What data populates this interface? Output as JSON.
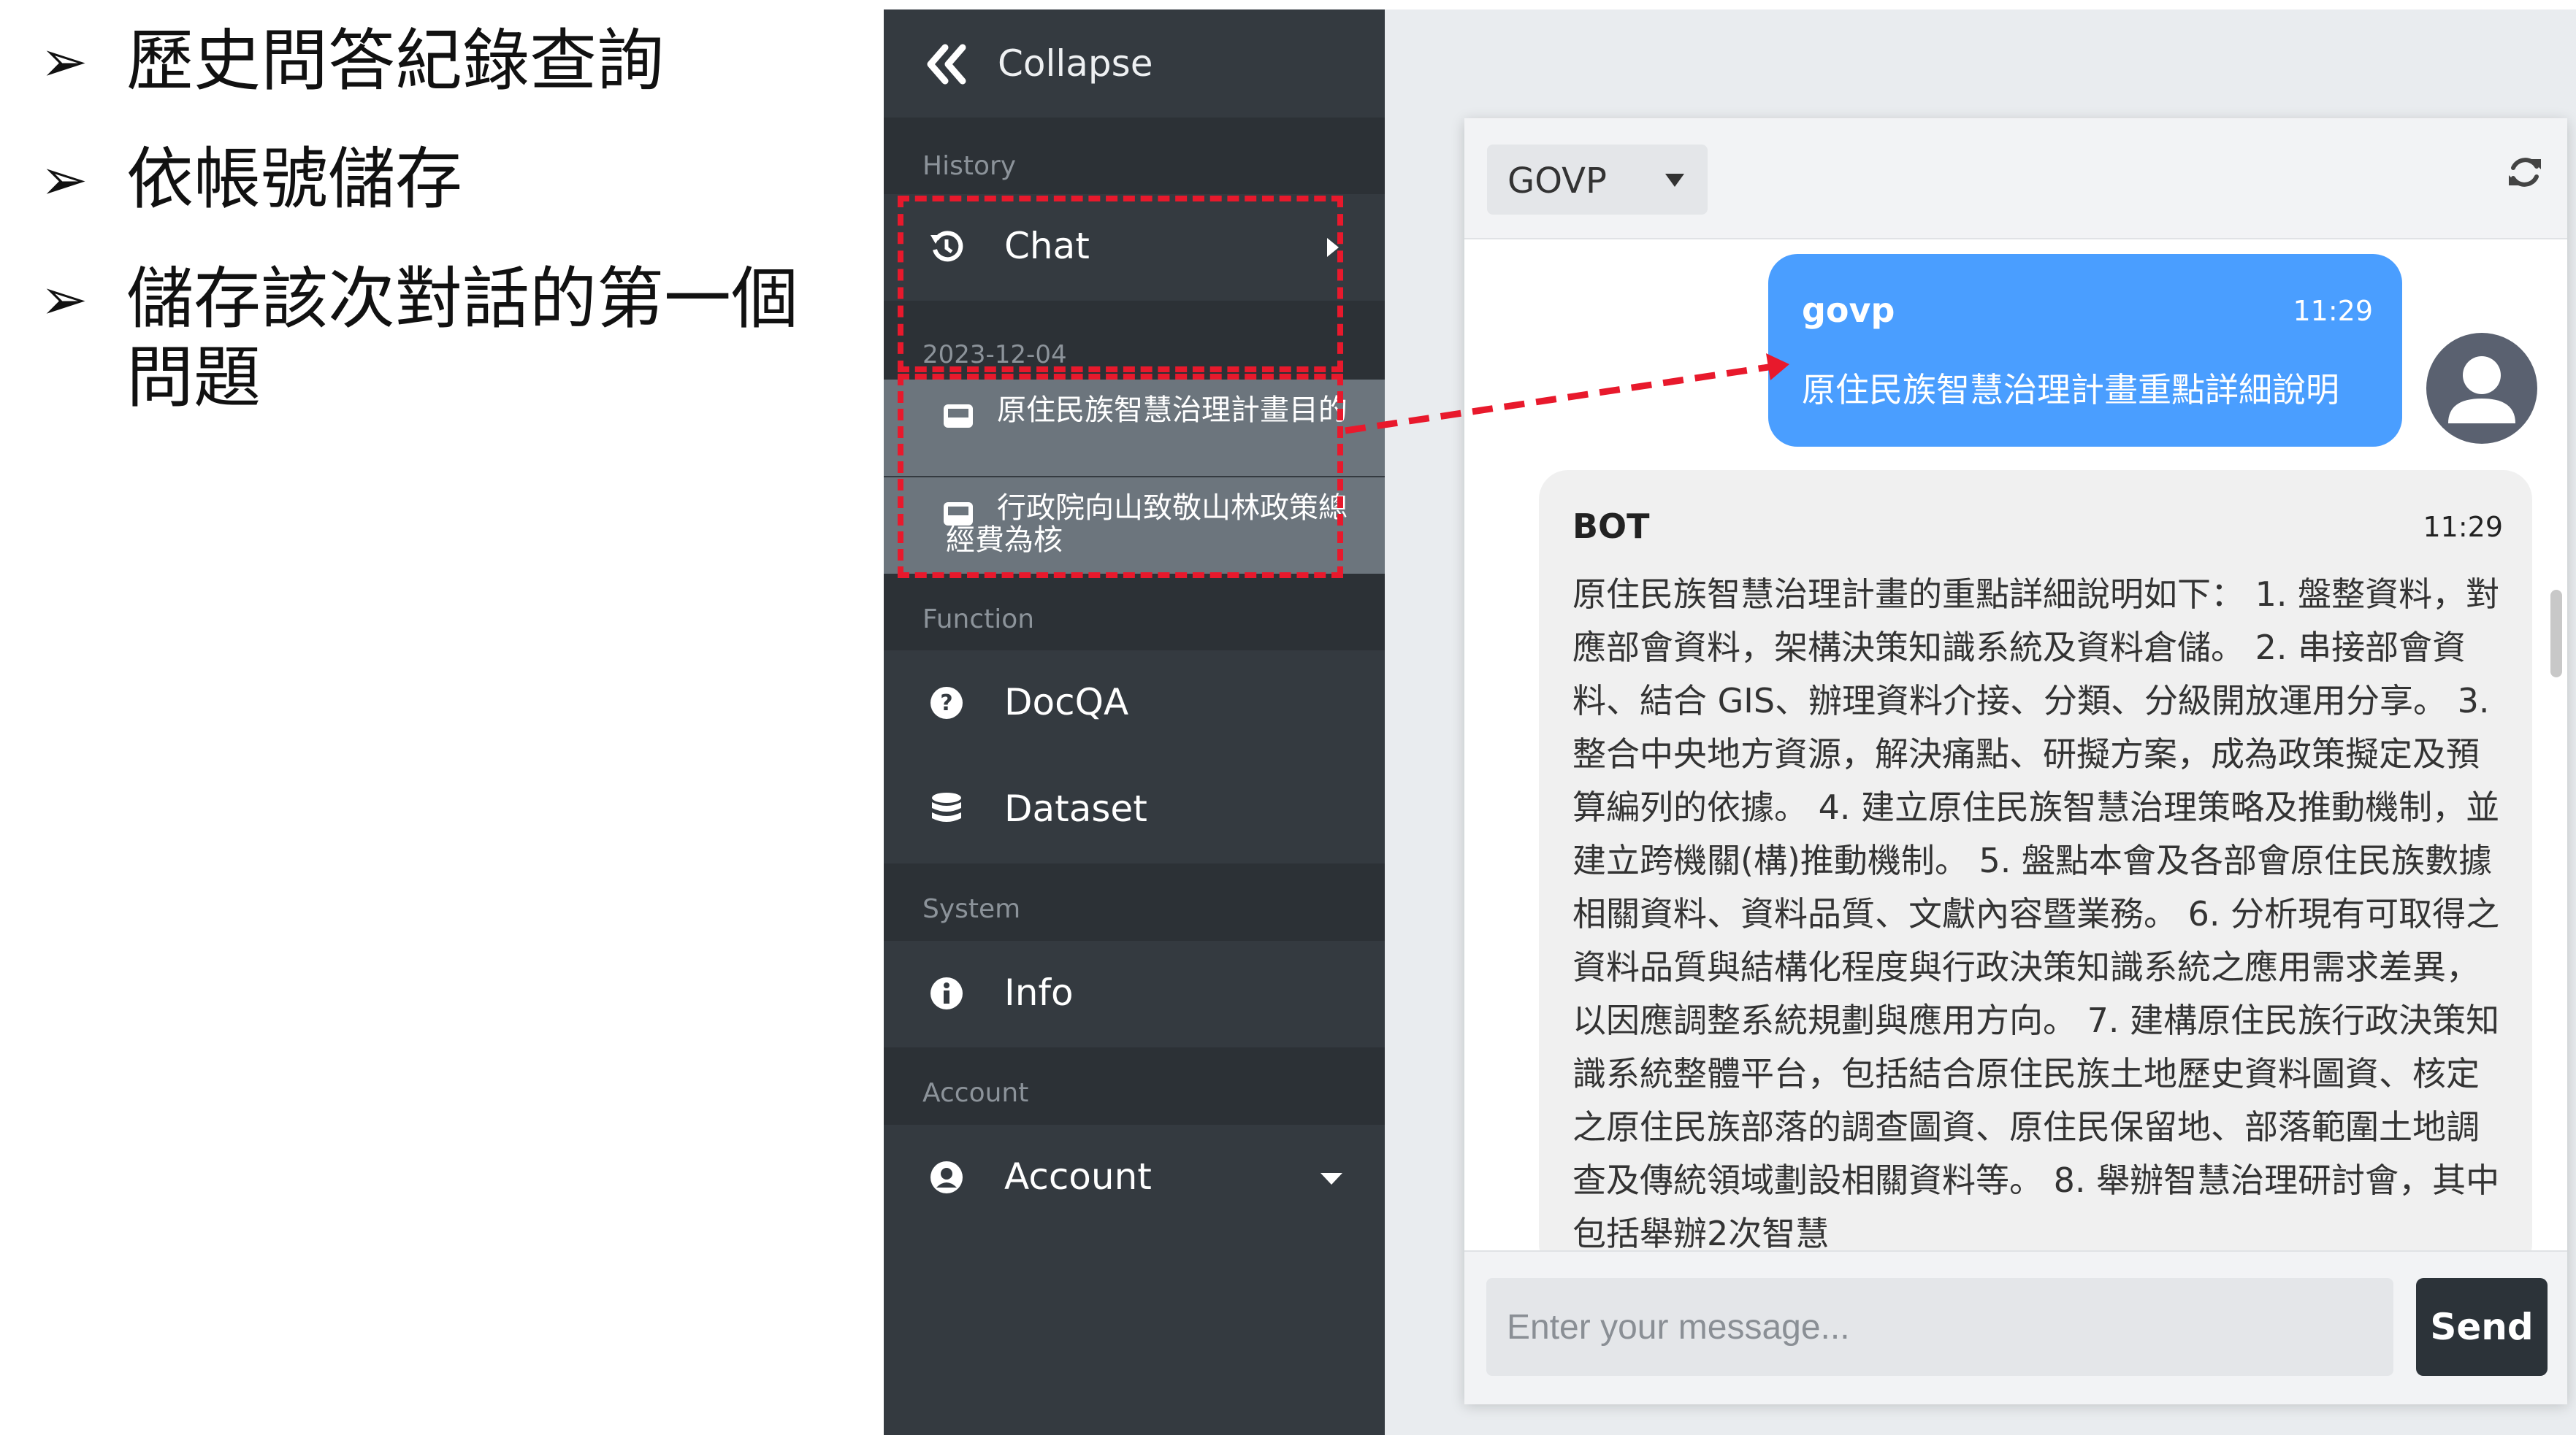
{
  "slide": {
    "bullets": [
      {
        "marker": "➢",
        "text": "歷史問答紀錄查詢"
      },
      {
        "marker": "➢",
        "text": "依帳號儲存"
      },
      {
        "marker": "➢",
        "text": "儲存該次對話的第一個問題"
      }
    ]
  },
  "sidebar": {
    "collapse_label": "Collapse",
    "sections": {
      "history": "History",
      "function": "Function",
      "system": "System",
      "account": "Account"
    },
    "chat_label": "Chat",
    "history_date": "2023-12-04",
    "history_items": [
      {
        "label": "原住民族智慧治理計畫目的",
        "icon": "inbox-icon"
      },
      {
        "label": "行政院向山致敬山林政策總經費為核",
        "icon": "inbox-icon"
      }
    ],
    "function_items": [
      {
        "label": "DocQA",
        "icon": "question-circle-icon"
      },
      {
        "label": "Dataset",
        "icon": "database-icon"
      }
    ],
    "system_items": [
      {
        "label": "Info",
        "icon": "info-circle-icon"
      }
    ],
    "account_label": "Account"
  },
  "chat": {
    "model": "GOVP",
    "user_message": {
      "name": "govp",
      "time": "11:29",
      "text": "原住民族智慧治理計畫重點詳細說明"
    },
    "bot_message": {
      "name": "BOT",
      "time": "11:29",
      "text": "原住民族智慧治理計畫的重點詳細說明如下： 1. 盤整資料，對應部會資料，架構決策知識系統及資料倉儲。 2. 串接部會資料、結合 GIS、辦理資料介接、分類、分級開放運用分享。 3. 整合中央地方資源，解決痛點、研擬方案，成為政策擬定及預算編列的依據。 4. 建立原住民族智慧治理策略及推動機制，並建立跨機關(構)推動機制。 5. 盤點本會及各部會原住民族數據相關資料、資料品質、文獻內容暨業務。 6. 分析現有可取得之資料品質與結構化程度與行政決策知識系統之應用需求差異，以因應調整系統規劃與應用方向。 7. 建構原住民族行政決策知識系統整體平台，包括結合原住民族土地歷史資料圖資、核定之原住民族部落的調查圖資、原住民保留地、部落範圍土地調查及傳統領域劃設相關資料等。 8. 舉辦智慧治理研討會，其中包括舉辦2次智慧"
    },
    "input_placeholder": "Enter your message...",
    "send_label": "Send"
  },
  "colors": {
    "sidebar_bg": "#343a40",
    "highlight": "#e8192c",
    "user_bubble": "#4a9eff",
    "send_button": "#2c3339"
  }
}
